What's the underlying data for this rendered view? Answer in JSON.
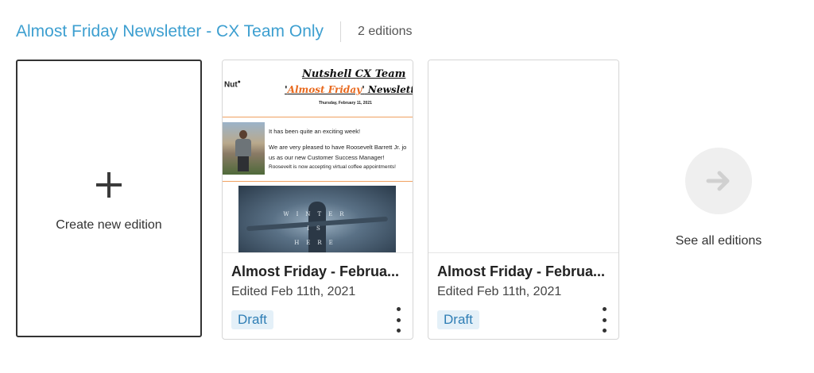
{
  "header": {
    "title": "Almost Friday Newsletter - CX Team Only",
    "count": "2 editions"
  },
  "create": {
    "label": "Create new edition",
    "icon": "plus-icon"
  },
  "editions": [
    {
      "title": "Almost Friday - Februa...",
      "edited": "Edited Feb 11th, 2021",
      "status": "Draft",
      "preview": {
        "logo": "Nut",
        "heading1": "Nutshell CX Team",
        "heading2_quote_open": "'",
        "heading2_orange": "Almost Friday",
        "heading2_quote_close": "'",
        "heading2_rest": " Newsletter",
        "date": "Thursday, February 11, 2021",
        "line1": "It has been quite an exciting week!",
        "line2": "We are very pleased to have Roosevelt Barrett Jr. jo",
        "line3": "us as our new Customer Success Manager!",
        "line4": "Roosevelt is now accepting virtual coffee appointments!",
        "image_w1": "WINTER",
        "image_w2": "IS",
        "image_w3": "HERE"
      }
    },
    {
      "title": "Almost Friday - Februa...",
      "edited": "Edited Feb 11th, 2021",
      "status": "Draft"
    }
  ],
  "see_all": {
    "label": "See all editions",
    "icon": "arrow-right-icon"
  },
  "colors": {
    "title": "#3d9fd0",
    "badge_bg": "#e4f0f8",
    "badge_text": "#2f7eb5",
    "accent_orange": "#e8691e"
  }
}
